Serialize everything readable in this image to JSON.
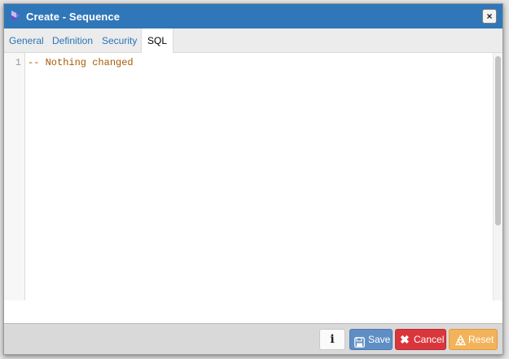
{
  "dialog": {
    "title": "Create - Sequence",
    "title_icon": "sequence-icon",
    "close_label": "×"
  },
  "tabs": [
    {
      "label": "General",
      "active": false
    },
    {
      "label": "Definition",
      "active": false
    },
    {
      "label": "Security",
      "active": false
    },
    {
      "label": "SQL",
      "active": true
    }
  ],
  "editor": {
    "line_numbers": [
      "1"
    ],
    "lines": [
      "-- Nothing changed"
    ]
  },
  "footer": {
    "info_label": "i",
    "save_label": "Save",
    "cancel_label": "Cancel",
    "reset_label": "Reset"
  },
  "colors": {
    "titlebar": "#2f77b8",
    "tab_link": "#2a74b5",
    "comment": "#a65a00",
    "save": "#5e8ec4",
    "cancel": "#d9363c",
    "reset": "#f2b35a"
  }
}
